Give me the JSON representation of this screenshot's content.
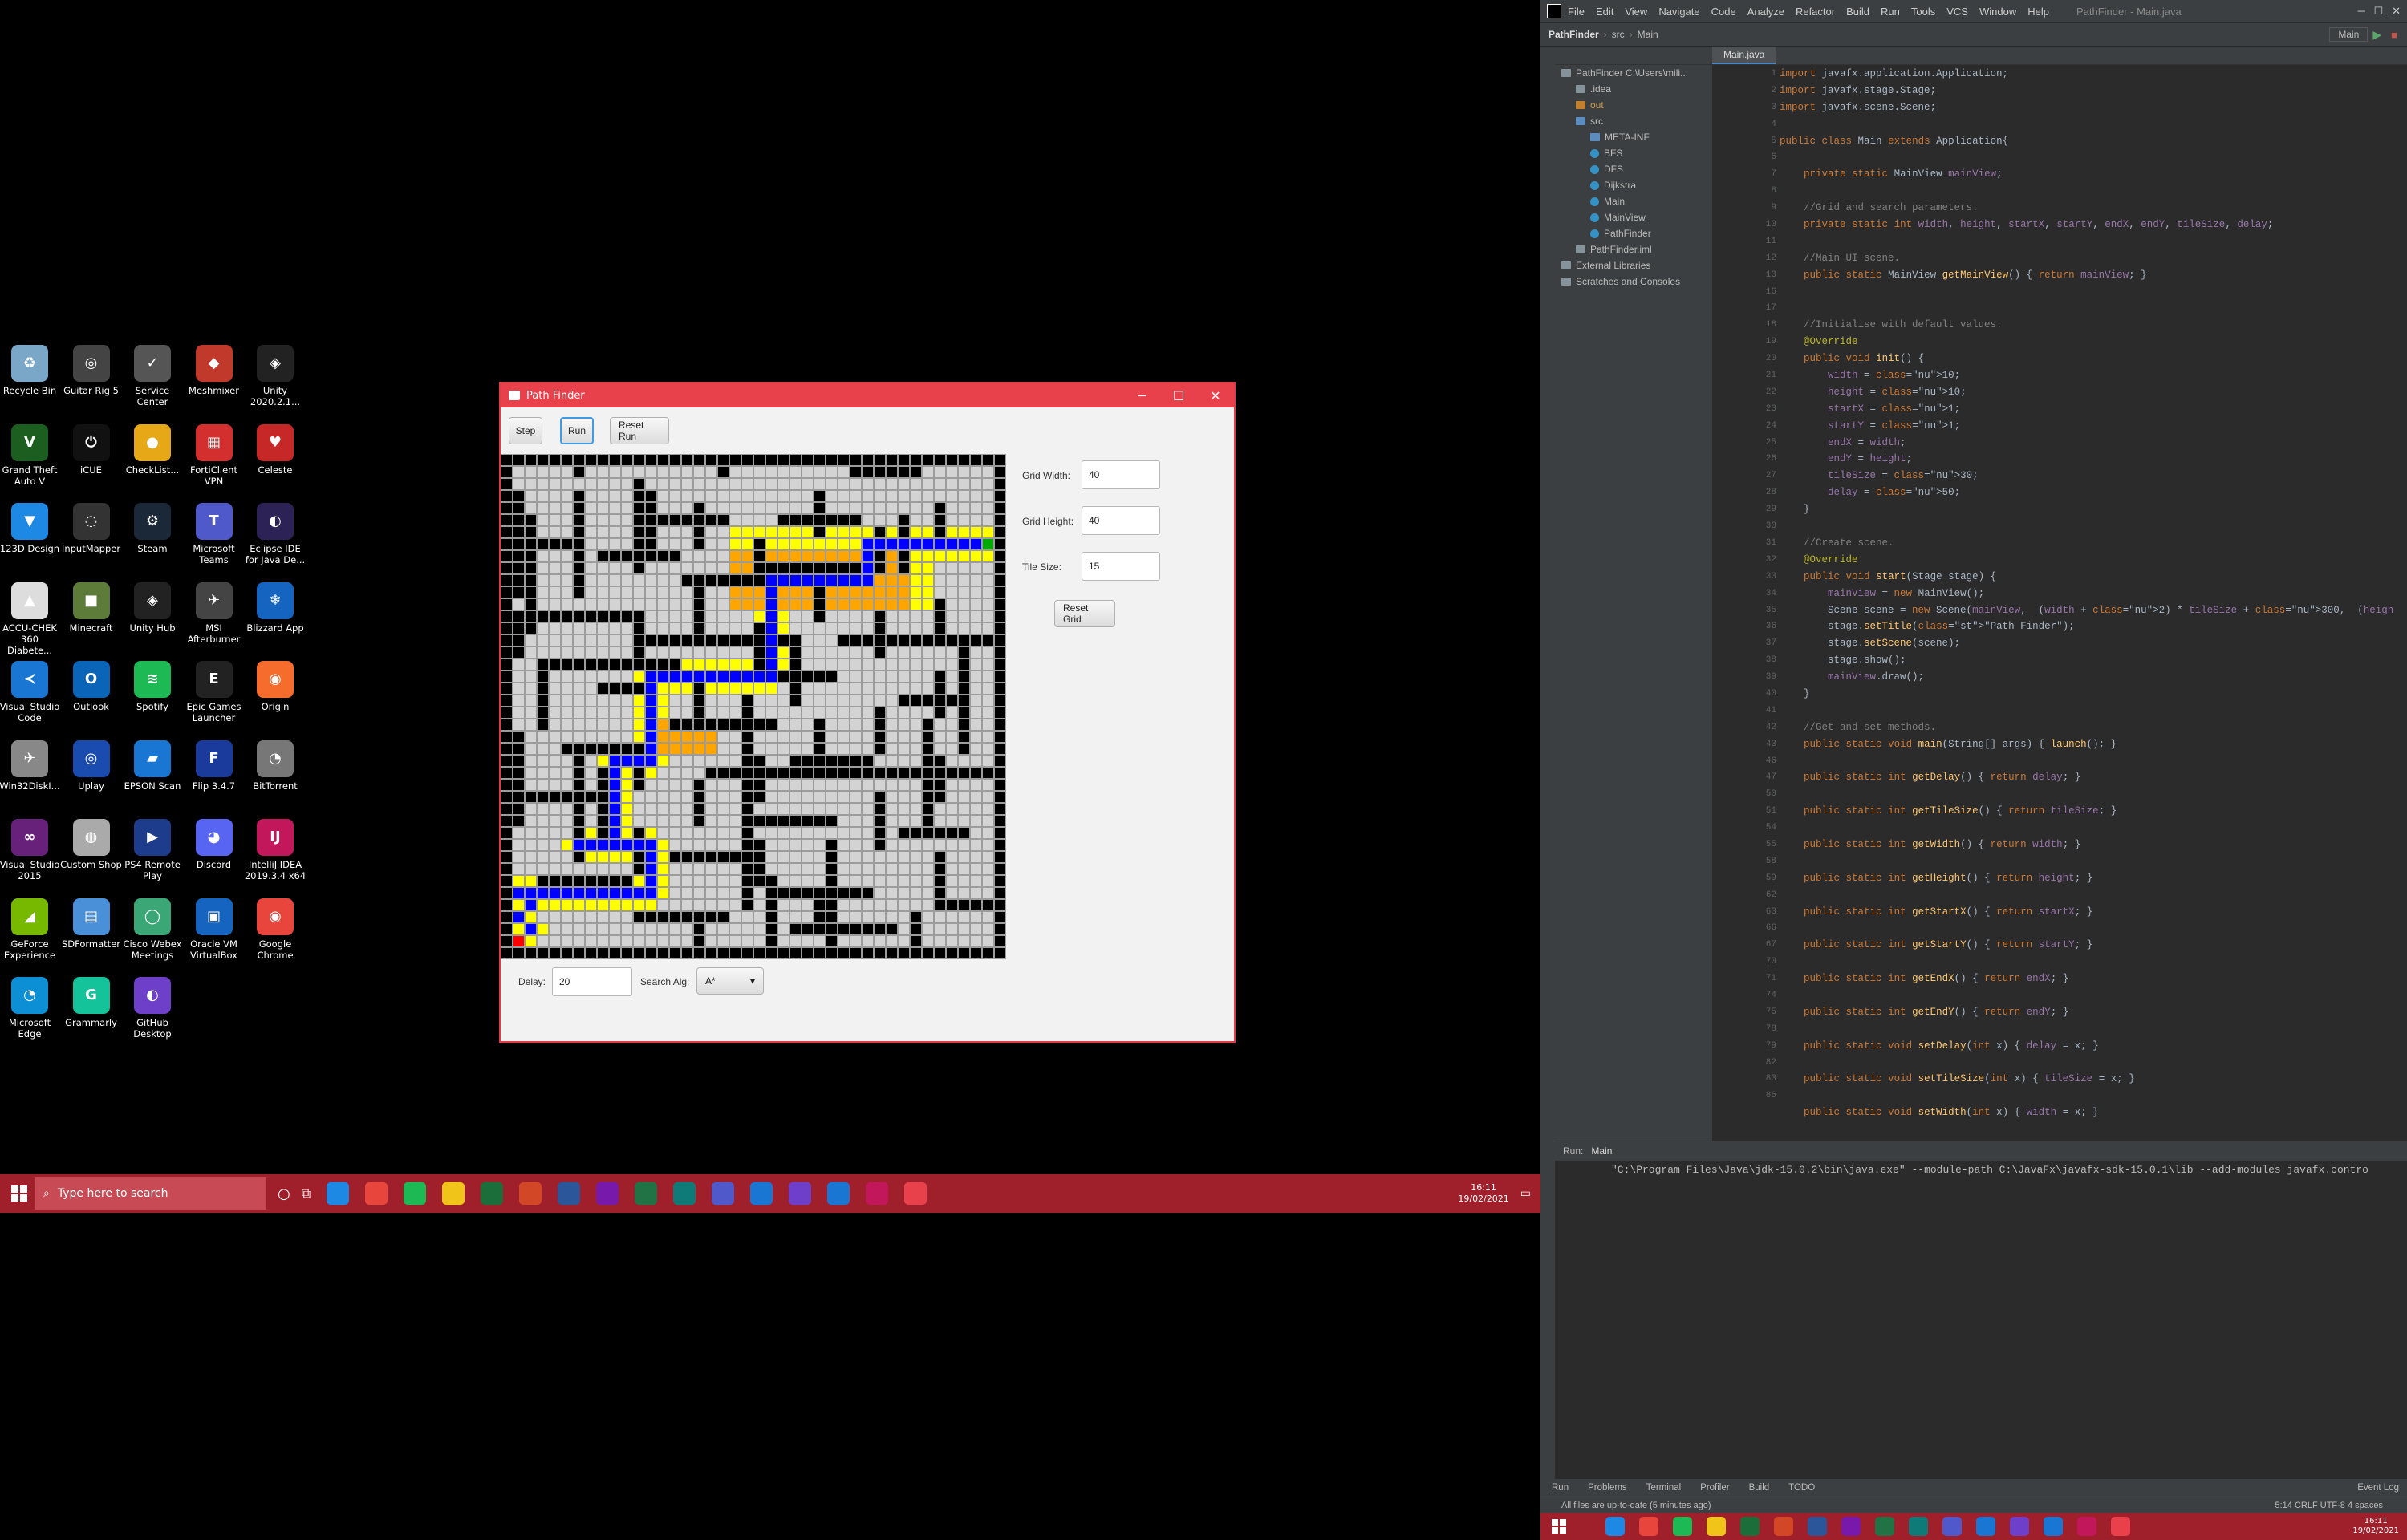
{
  "desktop": {
    "icons": [
      {
        "label": "Recycle Bin",
        "color": "#7aa7c7",
        "glyph": "♻"
      },
      {
        "label": "Guitar Rig 5",
        "color": "#444",
        "glyph": "◎"
      },
      {
        "label": "Service Center",
        "color": "#555",
        "glyph": "✓"
      },
      {
        "label": "Meshmixer",
        "color": "#c0392b",
        "glyph": "◆"
      },
      {
        "label": "Unity 2020.2.1...",
        "color": "#222",
        "glyph": "◈"
      },
      {
        "label": "Grand Theft Auto V",
        "color": "#1b5e20",
        "glyph": "V"
      },
      {
        "label": "iCUE",
        "color": "#111",
        "glyph": "⏻"
      },
      {
        "label": "CheckList...",
        "color": "#e6a817",
        "glyph": "●"
      },
      {
        "label": "FortiClient VPN",
        "color": "#d32f2f",
        "glyph": "▦"
      },
      {
        "label": "Celeste",
        "color": "#c62828",
        "glyph": "♥"
      },
      {
        "label": "123D Design",
        "color": "#1e88e5",
        "glyph": "▼"
      },
      {
        "label": "InputMapper",
        "color": "#333",
        "glyph": "◌"
      },
      {
        "label": "Steam",
        "color": "#1b2838",
        "glyph": "⚙"
      },
      {
        "label": "Microsoft Teams",
        "color": "#5059c9",
        "glyph": "T"
      },
      {
        "label": "Eclipse IDE for Java De...",
        "color": "#2c2255",
        "glyph": "◐"
      },
      {
        "label": "ACCU-CHEK 360 Diabete...",
        "color": "#ddd",
        "glyph": "▲"
      },
      {
        "label": "Minecraft",
        "color": "#5d7c3a",
        "glyph": "■"
      },
      {
        "label": "Unity Hub",
        "color": "#222",
        "glyph": "◈"
      },
      {
        "label": "MSI Afterburner",
        "color": "#444",
        "glyph": "✈"
      },
      {
        "label": "Blizzard App",
        "color": "#1565c0",
        "glyph": "❄"
      },
      {
        "label": "Visual Studio Code",
        "color": "#1976d2",
        "glyph": "≺"
      },
      {
        "label": "Outlook",
        "color": "#0a64b8",
        "glyph": "O"
      },
      {
        "label": "Spotify",
        "color": "#1db954",
        "glyph": "≋"
      },
      {
        "label": "Epic Games Launcher",
        "color": "#222",
        "glyph": "E"
      },
      {
        "label": "Origin",
        "color": "#f56c2d",
        "glyph": "◉"
      },
      {
        "label": "Win32DiskI...",
        "color": "#888",
        "glyph": "✈"
      },
      {
        "label": "Uplay",
        "color": "#1a4cb0",
        "glyph": "◎"
      },
      {
        "label": "EPSON Scan",
        "color": "#1976d2",
        "glyph": "▰"
      },
      {
        "label": "Flip 3.4.7",
        "color": "#1a3a9c",
        "glyph": "F"
      },
      {
        "label": "BitTorrent",
        "color": "#777",
        "glyph": "◔"
      },
      {
        "label": "Visual Studio 2015",
        "color": "#68217a",
        "glyph": "∞"
      },
      {
        "label": "Custom Shop",
        "color": "#aaa",
        "glyph": "◍"
      },
      {
        "label": "PS4 Remote Play",
        "color": "#1e3c8c",
        "glyph": "▶"
      },
      {
        "label": "Discord",
        "color": "#5865f2",
        "glyph": "◕"
      },
      {
        "label": "IntelliJ IDEA 2019.3.4 x64",
        "color": "#c2185b",
        "glyph": "IJ"
      },
      {
        "label": "GeForce Experience",
        "color": "#76b900",
        "glyph": "◢"
      },
      {
        "label": "SDFormatter",
        "color": "#4a90d9",
        "glyph": "▤"
      },
      {
        "label": "Cisco Webex Meetings",
        "color": "#3ba776",
        "glyph": "◯"
      },
      {
        "label": "Oracle VM VirtualBox",
        "color": "#1565c0",
        "glyph": "▣"
      },
      {
        "label": "Google Chrome",
        "color": "#e8453c",
        "glyph": "◉"
      },
      {
        "label": "Microsoft Edge",
        "color": "#0c8fd4",
        "glyph": "◔"
      },
      {
        "label": "Grammarly",
        "color": "#15c39a",
        "glyph": "G"
      },
      {
        "label": "GitHub Desktop",
        "color": "#6e40c9",
        "glyph": "◐"
      }
    ]
  },
  "pathfinder": {
    "title": "Path Finder",
    "buttons": {
      "step": "Step",
      "run": "Run",
      "reset_run": "Reset Run",
      "reset_grid": "Reset Grid"
    },
    "labels": {
      "grid_width": "Grid Width:",
      "grid_height": "Grid Height:",
      "tile_size": "Tile Size:",
      "delay": "Delay:",
      "search_alg": "Search Alg:"
    },
    "values": {
      "grid_width": "40",
      "grid_height": "40",
      "tile_size": "15",
      "delay": "20",
      "search_alg": "A*"
    },
    "colors": {
      "wall": "#000000",
      "empty": "#d3d3d3",
      "open": "#ffff00",
      "closed": "#ffa500",
      "path": "#0000ff",
      "start": "#ff0000",
      "end": "#00aa00"
    }
  },
  "ide": {
    "menu": [
      "File",
      "Edit",
      "View",
      "Navigate",
      "Code",
      "Analyze",
      "Refactor",
      "Build",
      "Run",
      "Tools",
      "VCS",
      "Window",
      "Help"
    ],
    "window_title": "PathFinder - Main.java",
    "breadcrumb": [
      "PathFinder",
      "src",
      "Main"
    ],
    "run_config": "Main",
    "project_tree": [
      {
        "label": "PathFinder  C:\\Users\\mili...",
        "indent": 0,
        "type": "folder"
      },
      {
        "label": ".idea",
        "indent": 1,
        "type": "folder"
      },
      {
        "label": "out",
        "indent": 1,
        "type": "folder"
      },
      {
        "label": "src",
        "indent": 1,
        "type": "folder"
      },
      {
        "label": "META-INF",
        "indent": 2,
        "type": "folder"
      },
      {
        "label": "BFS",
        "indent": 2,
        "type": "class"
      },
      {
        "label": "DFS",
        "indent": 2,
        "type": "class"
      },
      {
        "label": "Dijkstra",
        "indent": 2,
        "type": "class"
      },
      {
        "label": "Main",
        "indent": 2,
        "type": "class"
      },
      {
        "label": "MainView",
        "indent": 2,
        "type": "class"
      },
      {
        "label": "PathFinder",
        "indent": 2,
        "type": "class"
      },
      {
        "label": "PathFinder.iml",
        "indent": 1,
        "type": "file"
      },
      {
        "label": "External Libraries",
        "indent": 0,
        "type": "folder"
      },
      {
        "label": "Scratches and Consoles",
        "indent": 0,
        "type": "folder"
      }
    ],
    "editor_tab": "Main.java",
    "line_numbers": [
      "1",
      "2",
      "3",
      "4",
      "5",
      "6",
      "7",
      "8",
      "9",
      "10",
      "11",
      "12",
      "13",
      "16",
      "17",
      "18",
      "19",
      "20",
      "21",
      "22",
      "23",
      "24",
      "25",
      "26",
      "27",
      "28",
      "29",
      "30",
      "31",
      "32",
      "33",
      "34",
      "35",
      "36",
      "37",
      "38",
      "39",
      "40",
      "41",
      "42",
      "43",
      "46",
      "47",
      "50",
      "51",
      "54",
      "55",
      "58",
      "59",
      "62",
      "63",
      "66",
      "67",
      "70",
      "71",
      "74",
      "75",
      "78",
      "79",
      "82",
      "83",
      "86"
    ],
    "code_lines": [
      "import javafx.application.Application;",
      "import javafx.stage.Stage;",
      "import javafx.scene.Scene;",
      "",
      "public class Main extends Application{",
      "",
      "    private static MainView mainView;",
      "",
      "    //Grid and search parameters.",
      "    private static int width, height, startX, startY, endX, endY, tileSize, delay;",
      "",
      "    //Main UI scene.",
      "    public static MainView getMainView() { return mainView; }",
      "",
      "",
      "    //Initialise with default values.",
      "    @Override",
      "    public void init() {",
      "        width = 10;",
      "        height = 10;",
      "        startX = 1;",
      "        startY = 1;",
      "        endX = width;",
      "        endY = height;",
      "        tileSize = 30;",
      "        delay = 50;",
      "    }",
      "",
      "    //Create scene.",
      "    @Override",
      "    public void start(Stage stage) {",
      "        mainView = new MainView();",
      "        Scene scene = new Scene(mainView,  (width + 2) * tileSize + 300,  (height + 2) * tileSize",
      "        stage.setTitle(\"Path Finder\");",
      "        stage.setScene(scene);",
      "        stage.show();",
      "        mainView.draw();",
      "    }",
      "",
      "    //Get and set methods.",
      "    public static void main(String[] args) { launch(); }",
      "",
      "    public static int getDelay() { return delay; }",
      "",
      "    public static int getTileSize() { return tileSize; }",
      "",
      "    public static int getWidth() { return width; }",
      "",
      "    public static int getHeight() { return height; }",
      "",
      "    public static int getStartX() { return startX; }",
      "",
      "    public static int getStartY() { return startY; }",
      "",
      "    public static int getEndX() { return endX; }",
      "",
      "    public static int getEndY() { return endY; }",
      "",
      "    public static void setDelay(int x) { delay = x; }",
      "",
      "    public static void setTileSize(int x) { tileSize = x; }",
      "",
      "    public static void setWidth(int x) { width = x; }"
    ],
    "run_panel": {
      "label": "Run:",
      "tab": "Main",
      "command": "\"C:\\Program Files\\Java\\jdk-15.0.2\\bin\\java.exe\" --module-path C:\\JavaFx\\javafx-sdk-15.0.1\\lib --add-modules javafx.contro"
    },
    "bottom_tabs": [
      "Run",
      "Problems",
      "Terminal",
      "Profiler",
      "Build",
      "TODO"
    ],
    "event_log": "Event Log",
    "status_message": "All files are up-to-date (5 minutes ago)",
    "status_right": "5:14  CRLF  UTF-8  4 spaces"
  },
  "taskbar": {
    "search_placeholder": "Type here to search",
    "time": "16:11",
    "date": "19/02/2021",
    "apps": [
      "#1e88e5",
      "#e8453c",
      "#1db954",
      "#f0c419",
      "#1b6e3a",
      "#d24726",
      "#2b579a",
      "#7719aa",
      "#217346",
      "#0f7b78",
      "#5059c9",
      "#1976d2",
      "#6e40c9",
      "#1976d2",
      "#c2185b",
      "#e8414c"
    ]
  }
}
